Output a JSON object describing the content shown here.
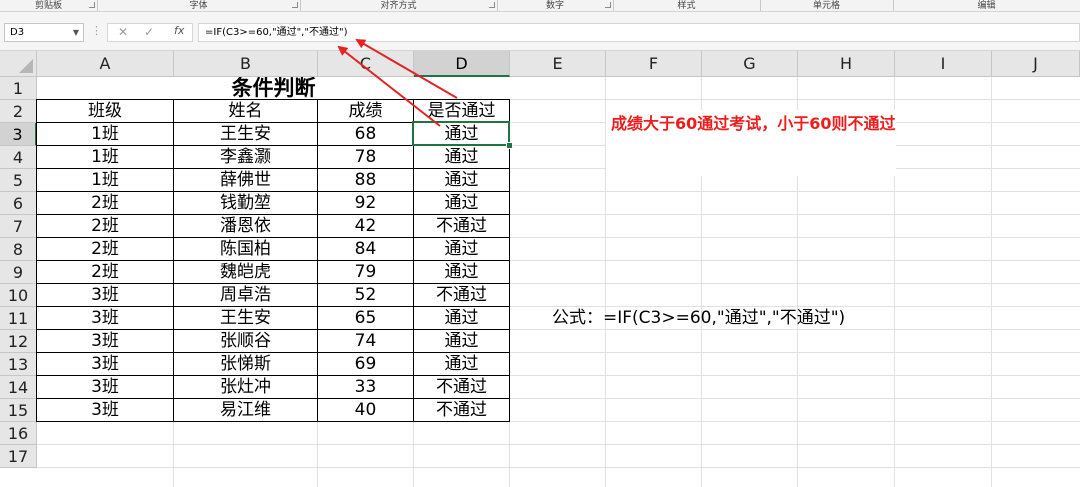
{
  "ribbon": {
    "groups": [
      "剪贴板",
      "字体",
      "对齐方式",
      "数字",
      "样式",
      "单元格",
      "编辑"
    ]
  },
  "formula_bar": {
    "name_box": "D3",
    "cancel_icon": "close-icon",
    "enter_icon": "check-icon",
    "fx_label": "fx",
    "formula": "=IF(C3>=60,\"通过\",\"不通过\")"
  },
  "sheet": {
    "columns": [
      "A",
      "B",
      "C",
      "D",
      "E",
      "F",
      "G",
      "H",
      "I",
      "J"
    ],
    "rows": [
      "1",
      "2",
      "3",
      "4",
      "5",
      "6",
      "7",
      "8",
      "9",
      "10",
      "11",
      "12",
      "13",
      "14",
      "15",
      "16",
      "17"
    ],
    "selected_cell": "D3",
    "title": "条件判断",
    "headers": [
      "班级",
      "姓名",
      "成绩",
      "是否通过"
    ],
    "data": [
      [
        "1班",
        "王生安",
        "68",
        "通过"
      ],
      [
        "1班",
        "李鑫灏",
        "78",
        "通过"
      ],
      [
        "1班",
        "薛佛世",
        "88",
        "通过"
      ],
      [
        "2班",
        "钱勤堃",
        "92",
        "通过"
      ],
      [
        "2班",
        "潘恩依",
        "42",
        "不通过"
      ],
      [
        "2班",
        "陈国柏",
        "84",
        "通过"
      ],
      [
        "2班",
        "魏皑虎",
        "79",
        "通过"
      ],
      [
        "3班",
        "周卓浩",
        "52",
        "不通过"
      ],
      [
        "3班",
        "王生安",
        "65",
        "通过"
      ],
      [
        "3班",
        "张顺谷",
        "74",
        "通过"
      ],
      [
        "3班",
        "张悌斯",
        "69",
        "通过"
      ],
      [
        "3班",
        "张灶冲",
        "33",
        "不通过"
      ],
      [
        "3班",
        "易江维",
        "40",
        "不通过"
      ]
    ],
    "note": "成绩大于60通过考试，小于60则不通过",
    "formula_note": "公式：=IF(C3>=60,\"通过\",\"不通过\")"
  },
  "colors": {
    "accent_green": "#217346",
    "annotation_red": "#ee1c1c"
  }
}
